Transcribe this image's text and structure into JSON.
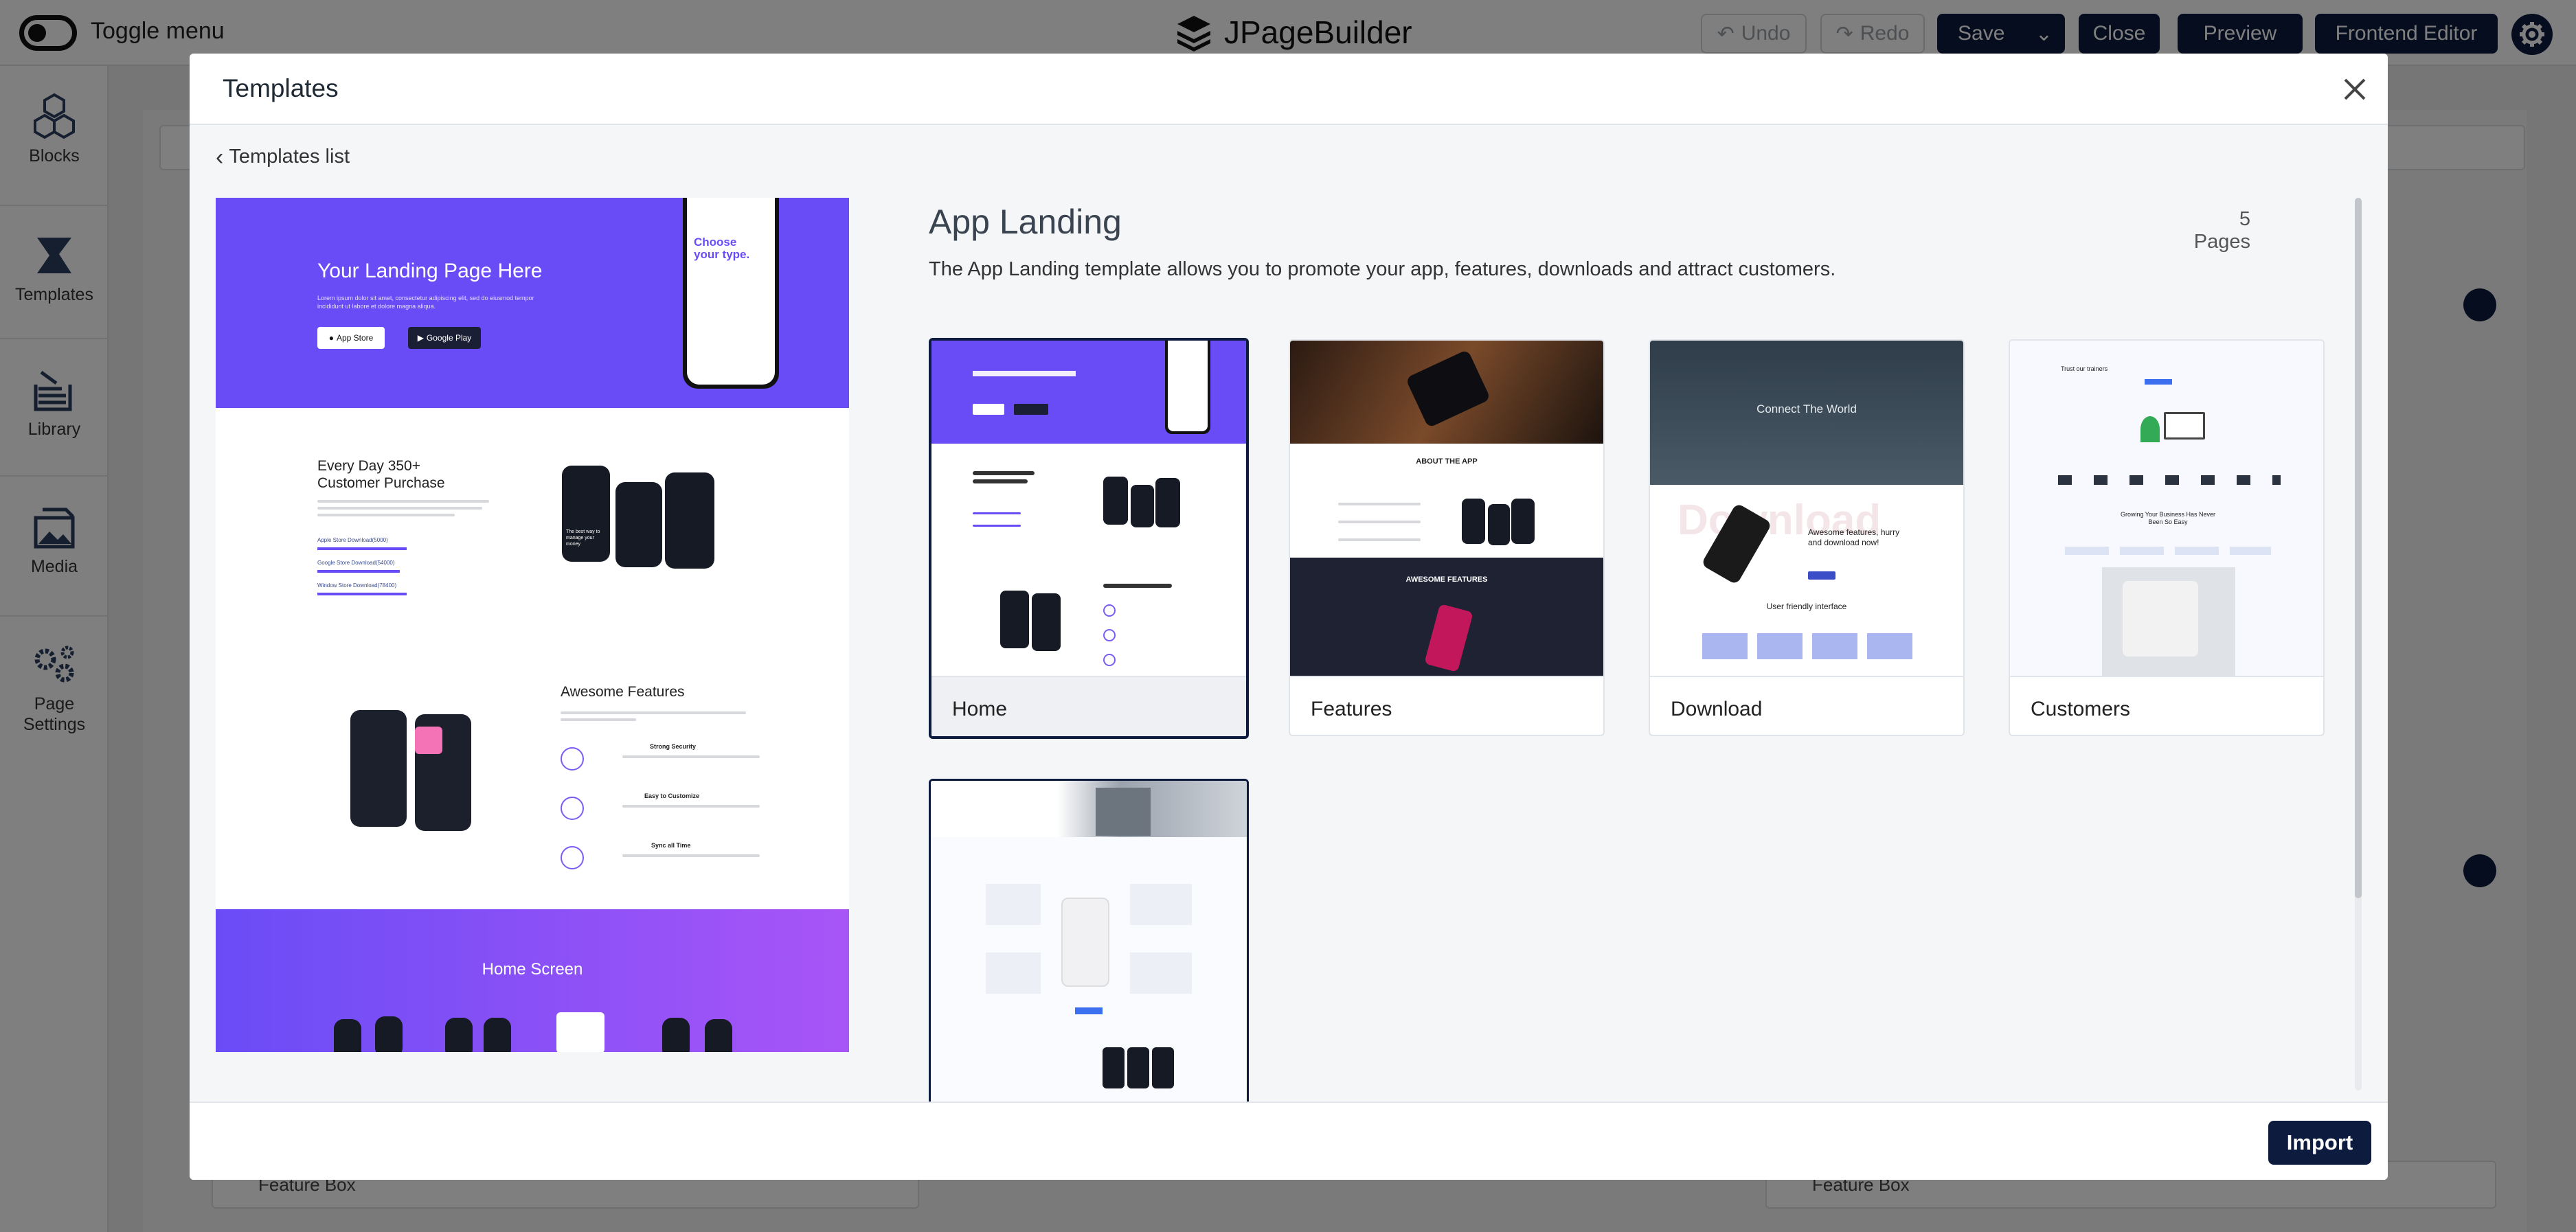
{
  "app": {
    "toggle_label": "Toggle menu",
    "brand": "JPageBuilder"
  },
  "toolbar": {
    "undo": "Undo",
    "redo": "Redo",
    "save": "Save",
    "close": "Close",
    "preview": "Preview",
    "frontend_editor": "Frontend Editor"
  },
  "sidebar": {
    "items": [
      {
        "label": "Blocks",
        "icon": "cubes-icon"
      },
      {
        "label": "Templates",
        "icon": "templates-icon"
      },
      {
        "label": "Library",
        "icon": "library-icon"
      },
      {
        "label": "Media",
        "icon": "media-icon"
      },
      {
        "label": "Page Settings",
        "icon": "gears-icon"
      }
    ]
  },
  "background": {
    "feature_box_left": "Feature Box",
    "feature_box_right": "Feature Box"
  },
  "modal": {
    "title": "Templates",
    "back_label": "Templates list",
    "template_name": "App Landing",
    "pages_count": "5 Pages",
    "description": "The App Landing template allows you to promote your app, features, downloads and attract customers.",
    "import_label": "Import",
    "preview": {
      "hero_title": "Your Landing Page Here",
      "hero_sub": "Lorem ipsum dolor sit amet, consectetur adipiscing elit, sed do eiusmod tempor incididunt ut labore et dolore magna aliqua.",
      "app_store": "App Store",
      "google_play": "Google Play",
      "phone_heading": "Choose your type.",
      "section2_title": "Every Day 350+ Customer Purchase",
      "stats": [
        "Apple Store Download(5000)",
        "Google Store Download(54000)",
        "Window Store Download(78400)"
      ],
      "phone_card_text": "The best way to manage your money",
      "section3_title": "Awesome Features",
      "features": [
        "Strong Security",
        "Easy to Customize",
        "Sync all Time"
      ],
      "section4_title": "Home Screen"
    },
    "pages": [
      {
        "label": "Home",
        "selected": true
      },
      {
        "label": "Features",
        "selected": false
      },
      {
        "label": "Download",
        "selected": false
      },
      {
        "label": "Customers",
        "selected": false
      },
      {
        "label": "",
        "selected": false
      }
    ],
    "thumb_text": {
      "features_about": "ABOUT THE APP",
      "features_awesome": "AWESOME FEATURES",
      "download_hero": "Connect The World",
      "download_watermark": "Download",
      "download_head": "Awesome features, hurry and download now!",
      "download_ui": "User friendly interface",
      "customers_head": "Trust our trainers",
      "customers_growing": "Growing Your Business Has Never Been So Easy"
    }
  },
  "colors": {
    "brand_navy": "#0d1b3e",
    "hero_purple": "#6a4cf6",
    "gradient_end": "#a855f7"
  }
}
